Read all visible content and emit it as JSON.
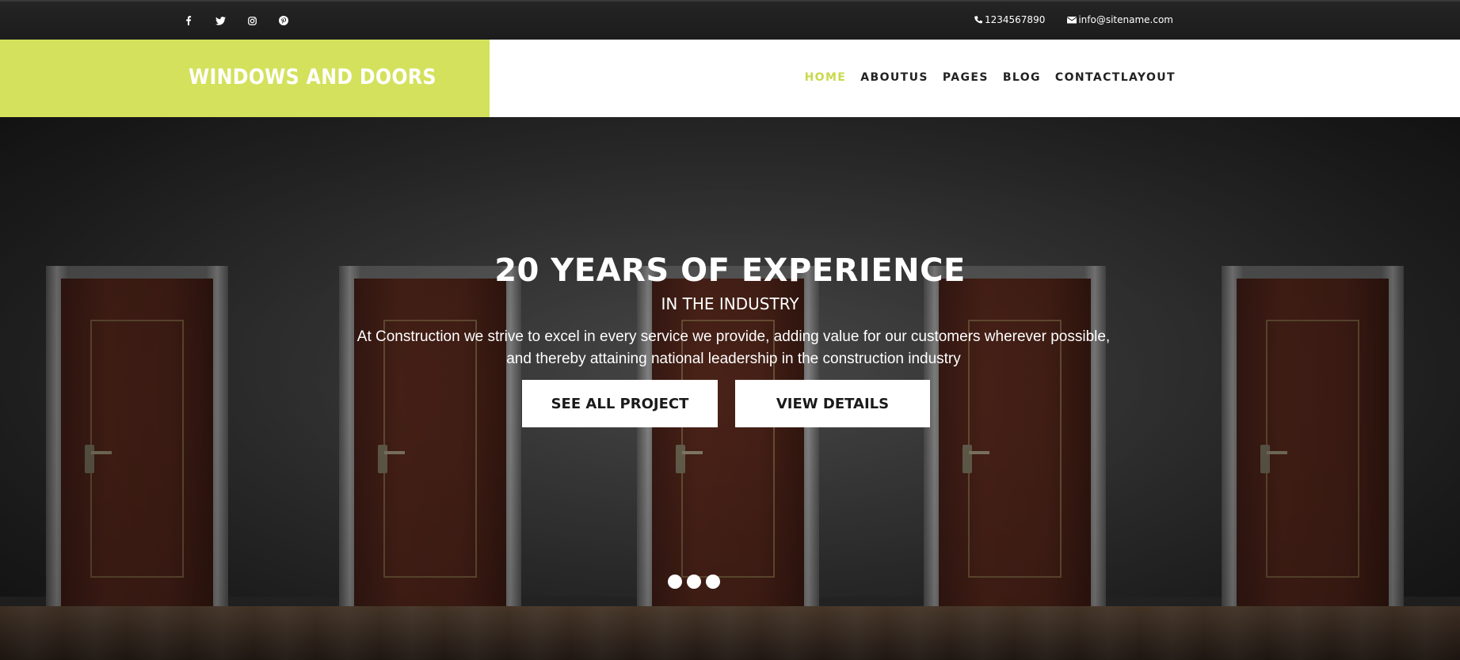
{
  "topbar": {
    "social": [
      {
        "icon": "facebook-icon"
      },
      {
        "icon": "twitter-icon"
      },
      {
        "icon": "instagram-icon"
      },
      {
        "icon": "pinterest-icon"
      }
    ],
    "phone": "1234567890",
    "email": "info@sitename.com"
  },
  "header": {
    "logo": "WINDOWS AND DOORS",
    "nav": [
      "HOME",
      "ABOUTUS",
      "PAGES",
      "BLOG",
      "CONTACTLAYOUT"
    ],
    "active_nav": "HOME"
  },
  "hero": {
    "title": "20 YEARS OF EXPERIENCE",
    "subtitle": "IN THE INDUSTRY",
    "description_line1": "At Construction we strive to excel in every service we provide, adding value for our customers wherever possible,",
    "description_line2": "and thereby attaining national leadership in the construction industry",
    "buttons": [
      "SEE ALL PROJECT",
      "VIEW DETAILS"
    ],
    "slide_count": 3
  },
  "colors": {
    "accent": "#d4e15c",
    "topbar": "#222222",
    "button_bg": "#ffffff"
  }
}
